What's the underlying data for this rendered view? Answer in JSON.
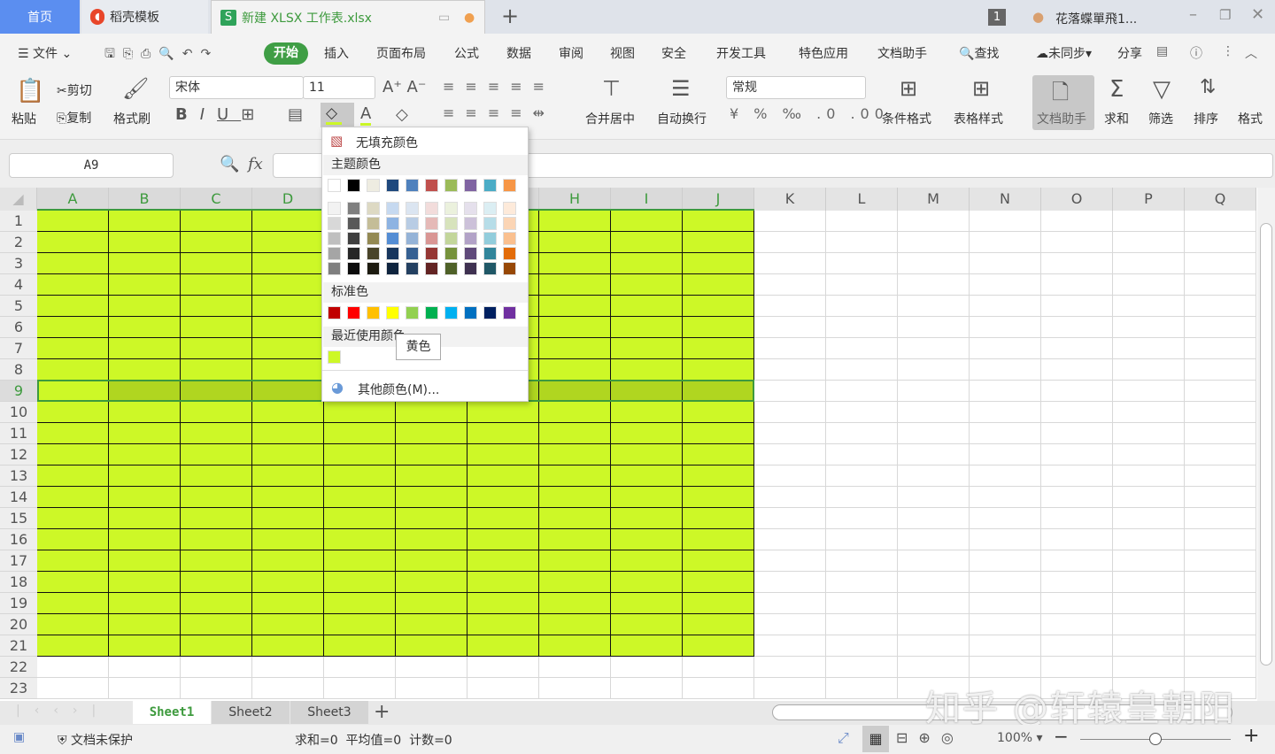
{
  "tabs": [
    {
      "label": "首页"
    },
    {
      "label": "稻壳模板"
    },
    {
      "label": "新建 XLSX 工作表.xlsx"
    }
  ],
  "window": {
    "badge": "1",
    "user": "花落蝶單飛1..."
  },
  "menu": {
    "file": "文件",
    "items": [
      "开始",
      "插入",
      "页面布局",
      "公式",
      "数据",
      "审阅",
      "视图",
      "安全",
      "开发工具",
      "特色应用",
      "文档助手"
    ],
    "search": "查找",
    "sync": "未同步",
    "share": "分享"
  },
  "ribbon": {
    "paste": "粘贴",
    "cut": "剪切",
    "copy": "复制",
    "format_painter": "格式刷",
    "font": "宋体",
    "size": "11",
    "merge": "合并居中",
    "wrap": "自动换行",
    "number_format": "常规",
    "cond_format": "条件格式",
    "table_style": "表格样式",
    "doc_helper": "文档助手",
    "sum": "求和",
    "filter": "筛选",
    "sort": "排序",
    "format": "格式"
  },
  "formula_bar": {
    "name_box": "A9",
    "fx": "fx",
    "value": ""
  },
  "grid": {
    "columns": [
      "A",
      "B",
      "C",
      "D",
      "E",
      "F",
      "G",
      "H",
      "I",
      "J",
      "K",
      "L",
      "M",
      "N",
      "O",
      "P",
      "Q"
    ],
    "rows": 23,
    "fill_color": "#cdf827",
    "fill_range": "A1:J21",
    "selected_row": 9,
    "active_cell": "A9",
    "selected_row_color": "#b0d620"
  },
  "palette": {
    "no_fill": "无填充颜色",
    "theme_label": "主题颜色",
    "standard_label": "标准色",
    "recent_label": "最近使用颜色",
    "more": "其他颜色(M)...",
    "theme": [
      "#ffffff",
      "#000000",
      "#eeece1",
      "#1f497d",
      "#4f81bd",
      "#c0504d",
      "#9bbb59",
      "#8064a2",
      "#4bacc6",
      "#f79646"
    ],
    "shades": [
      [
        "#f2f2f2",
        "#7f7f7f",
        "#ddd9c3",
        "#c6d9f0",
        "#dbe5f1",
        "#f2dcdb",
        "#ebf1dd",
        "#e5e0ec",
        "#dbeef3",
        "#fdeada"
      ],
      [
        "#d8d8d8",
        "#595959",
        "#c4bd97",
        "#8db3e2",
        "#b8cce4",
        "#e5b9b7",
        "#d7e3bc",
        "#ccc1d9",
        "#b7dde8",
        "#fbd5b5"
      ],
      [
        "#bfbfbf",
        "#3f3f3f",
        "#938953",
        "#548dd4",
        "#95b3d7",
        "#d99694",
        "#c3d69b",
        "#b2a2c7",
        "#92cddc",
        "#fac08f"
      ],
      [
        "#a5a5a5",
        "#262626",
        "#494429",
        "#17365d",
        "#366092",
        "#953734",
        "#76923c",
        "#5f497a",
        "#31859b",
        "#e36c09"
      ],
      [
        "#7f7f7f",
        "#0c0c0c",
        "#1d1b10",
        "#0f243e",
        "#244061",
        "#632423",
        "#4f6128",
        "#3f3151",
        "#205867",
        "#974806"
      ]
    ],
    "standard": [
      "#c00000",
      "#ff0000",
      "#ffc000",
      "#ffff00",
      "#92d050",
      "#00b050",
      "#00b0f0",
      "#0070c0",
      "#002060",
      "#7030a0"
    ],
    "recent": [
      "#cdf827"
    ],
    "tooltip": "黄色"
  },
  "sheets": [
    {
      "label": "Sheet1",
      "active": true
    },
    {
      "label": "Sheet2"
    },
    {
      "label": "Sheet3"
    }
  ],
  "status": {
    "protect": "文档未保护",
    "stats": "求和=0  平均值=0  计数=0",
    "zoom": "100%",
    "zoom_level": 0.5
  },
  "watermark": "知乎 @轩辕皇朝阳"
}
